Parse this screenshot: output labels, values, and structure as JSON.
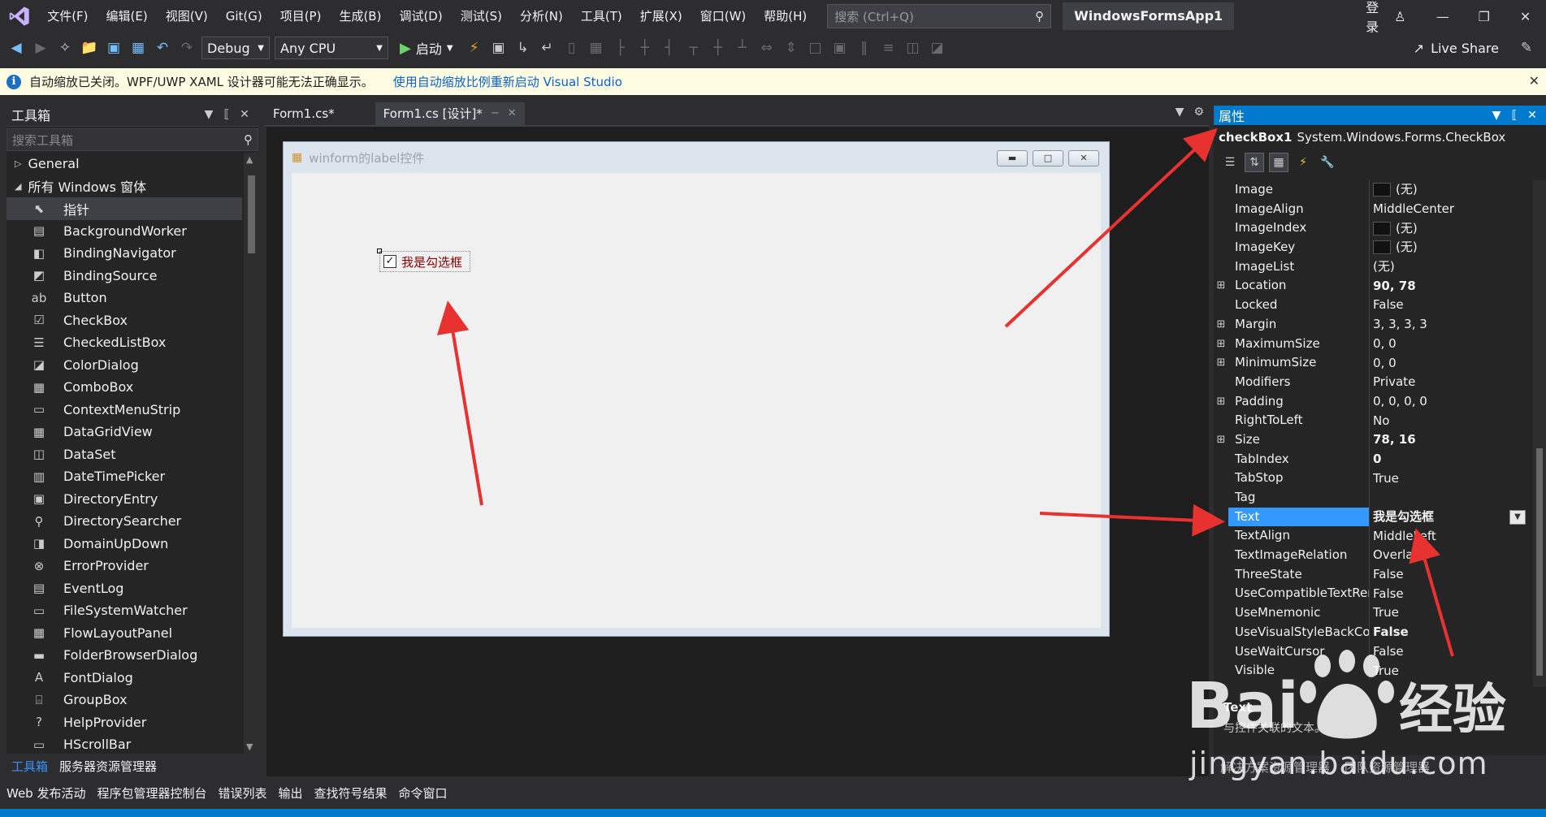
{
  "menu": {
    "items": [
      "文件(F)",
      "编辑(E)",
      "视图(V)",
      "Git(G)",
      "项目(P)",
      "生成(B)",
      "调试(D)",
      "测试(S)",
      "分析(N)",
      "工具(T)",
      "扩展(X)",
      "窗口(W)",
      "帮助(H)"
    ],
    "search_placeholder": "搜索 (Ctrl+Q)",
    "solution_name": "WindowsFormsApp1",
    "login": "登录"
  },
  "toolbar": {
    "config": "Debug",
    "platform": "Any CPU",
    "start_label": "启动",
    "live_share": "Live Share"
  },
  "infobar": {
    "message": "自动缩放已关闭。WPF/UWP XAML 设计器可能无法正确显示。",
    "link": "使用自动缩放比例重新启动 Visual Studio"
  },
  "toolbox": {
    "title": "工具箱",
    "search_placeholder": "搜索工具箱",
    "group_general": "General",
    "group_windows": "所有 Windows 窗体",
    "items": [
      {
        "label": "指针",
        "icon": "pointer-icon",
        "glyph": "⬉"
      },
      {
        "label": "BackgroundWorker",
        "icon": "background-worker-icon",
        "glyph": "▤"
      },
      {
        "label": "BindingNavigator",
        "icon": "binding-navigator-icon",
        "glyph": "◧"
      },
      {
        "label": "BindingSource",
        "icon": "binding-source-icon",
        "glyph": "◩"
      },
      {
        "label": "Button",
        "icon": "button-icon",
        "glyph": "ab"
      },
      {
        "label": "CheckBox",
        "icon": "checkbox-icon",
        "glyph": "☑"
      },
      {
        "label": "CheckedListBox",
        "icon": "checked-list-box-icon",
        "glyph": "☰"
      },
      {
        "label": "ColorDialog",
        "icon": "color-dialog-icon",
        "glyph": "◪"
      },
      {
        "label": "ComboBox",
        "icon": "combobox-icon",
        "glyph": "▦"
      },
      {
        "label": "ContextMenuStrip",
        "icon": "context-menu-icon",
        "glyph": "▭"
      },
      {
        "label": "DataGridView",
        "icon": "datagrid-icon",
        "glyph": "▦"
      },
      {
        "label": "DataSet",
        "icon": "dataset-icon",
        "glyph": "◫"
      },
      {
        "label": "DateTimePicker",
        "icon": "datetime-picker-icon",
        "glyph": "▥"
      },
      {
        "label": "DirectoryEntry",
        "icon": "directory-entry-icon",
        "glyph": "▣"
      },
      {
        "label": "DirectorySearcher",
        "icon": "directory-searcher-icon",
        "glyph": "⚲"
      },
      {
        "label": "DomainUpDown",
        "icon": "domain-updown-icon",
        "glyph": "◨"
      },
      {
        "label": "ErrorProvider",
        "icon": "error-provider-icon",
        "glyph": "⊗"
      },
      {
        "label": "EventLog",
        "icon": "eventlog-icon",
        "glyph": "▤"
      },
      {
        "label": "FileSystemWatcher",
        "icon": "filesystem-watcher-icon",
        "glyph": "▭"
      },
      {
        "label": "FlowLayoutPanel",
        "icon": "flow-layout-icon",
        "glyph": "▦"
      },
      {
        "label": "FolderBrowserDialog",
        "icon": "folder-browser-icon",
        "glyph": "▬"
      },
      {
        "label": "FontDialog",
        "icon": "font-dialog-icon",
        "glyph": "A"
      },
      {
        "label": "GroupBox",
        "icon": "groupbox-icon",
        "glyph": "⌸"
      },
      {
        "label": "HelpProvider",
        "icon": "help-provider-icon",
        "glyph": "?"
      },
      {
        "label": "HScrollBar",
        "icon": "hscrollbar-icon",
        "glyph": "▭"
      }
    ],
    "tab_toolbox": "工具箱",
    "tab_server": "服务器资源管理器"
  },
  "bottom_tabs": [
    "Web 发布活动",
    "程序包管理器控制台",
    "错误列表",
    "输出",
    "查找符号结果",
    "命令窗口"
  ],
  "doc_tabs": [
    {
      "label": "Form1.cs*",
      "active": false
    },
    {
      "label": "Form1.cs [设计]*",
      "active": true
    }
  ],
  "designer": {
    "form_title": "winform的label控件",
    "checkbox_text": "我是勾选框"
  },
  "properties": {
    "title": "属性",
    "object_name": "checkBox1",
    "object_type": "System.Windows.Forms.CheckBox",
    "rows": [
      {
        "name": "Image",
        "value": "(无)",
        "swatch": true
      },
      {
        "name": "ImageAlign",
        "value": "MiddleCenter"
      },
      {
        "name": "ImageIndex",
        "value": "(无)",
        "swatch": true
      },
      {
        "name": "ImageKey",
        "value": "(无)",
        "swatch": true
      },
      {
        "name": "ImageList",
        "value": "(无)"
      },
      {
        "name": "Location",
        "value": "90, 78",
        "bold": true,
        "expand": true
      },
      {
        "name": "Locked",
        "value": "False"
      },
      {
        "name": "Margin",
        "value": "3, 3, 3, 3",
        "expand": true
      },
      {
        "name": "MaximumSize",
        "value": "0, 0",
        "expand": true
      },
      {
        "name": "MinimumSize",
        "value": "0, 0",
        "expand": true
      },
      {
        "name": "Modifiers",
        "value": "Private"
      },
      {
        "name": "Padding",
        "value": "0, 0, 0, 0",
        "expand": true
      },
      {
        "name": "RightToLeft",
        "value": "No"
      },
      {
        "name": "Size",
        "value": "78, 16",
        "bold": true,
        "expand": true
      },
      {
        "name": "TabIndex",
        "value": "0",
        "bold": true
      },
      {
        "name": "TabStop",
        "value": "True"
      },
      {
        "name": "Tag",
        "value": ""
      },
      {
        "name": "Text",
        "value": "我是勾选框",
        "bold": true,
        "selected": true
      },
      {
        "name": "TextAlign",
        "value": "MiddleLeft"
      },
      {
        "name": "TextImageRelation",
        "value": "Overlay"
      },
      {
        "name": "ThreeState",
        "value": "False"
      },
      {
        "name": "UseCompatibleTextRendering",
        "value": "False"
      },
      {
        "name": "UseMnemonic",
        "value": "True"
      },
      {
        "name": "UseVisualStyleBackColor",
        "value": "False",
        "bold": true
      },
      {
        "name": "UseWaitCursor",
        "value": "False"
      },
      {
        "name": "Visible",
        "value": "True"
      }
    ],
    "desc_title": "Text",
    "desc_text": "与控件关联的文本。",
    "bottom_tab_1": "解决方案资源管理器",
    "bottom_tab_2": "团队资源管理器"
  },
  "watermark": {
    "brand": "Bai",
    "brand_cn": "经验",
    "url": "jingyan.baidu.com"
  },
  "colors": {
    "accent": "#007acc",
    "arrow": "#e8322f",
    "selected_row": "#3399ff"
  }
}
